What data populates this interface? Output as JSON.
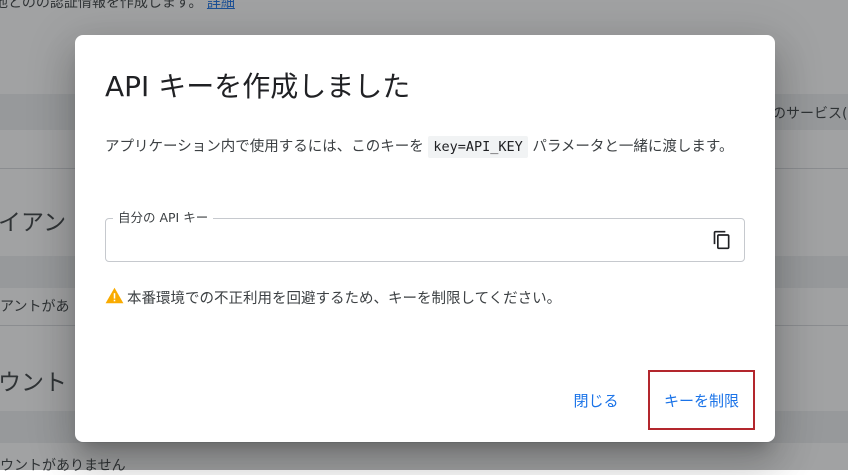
{
  "background": {
    "top_text": "他とのの認証情報を作成します。",
    "top_link": "詳細",
    "right_text": "のサービス(",
    "section_clients": "イアン",
    "no_clients": "アントがあ",
    "section_accounts": "ウント",
    "no_accounts": "ウントがありません"
  },
  "dialog": {
    "title": "API キーを作成しました",
    "description_before": "アプリケーション内で使用するには、このキーを",
    "description_code": "key=API_KEY",
    "description_after": "パラメータと一緒に渡します。",
    "field_label": "自分の API キー",
    "field_value": "",
    "copy_icon": "copy-icon",
    "warning_icon": "warning-icon",
    "warning_text": "本番環境での不正利用を回避するため、キーを制限してください。",
    "close_button": "閉じる",
    "restrict_button": "キーを制限"
  },
  "colors": {
    "accent": "#1a73e8",
    "warning": "#f9ab00",
    "highlight_border": "#b3262d"
  }
}
